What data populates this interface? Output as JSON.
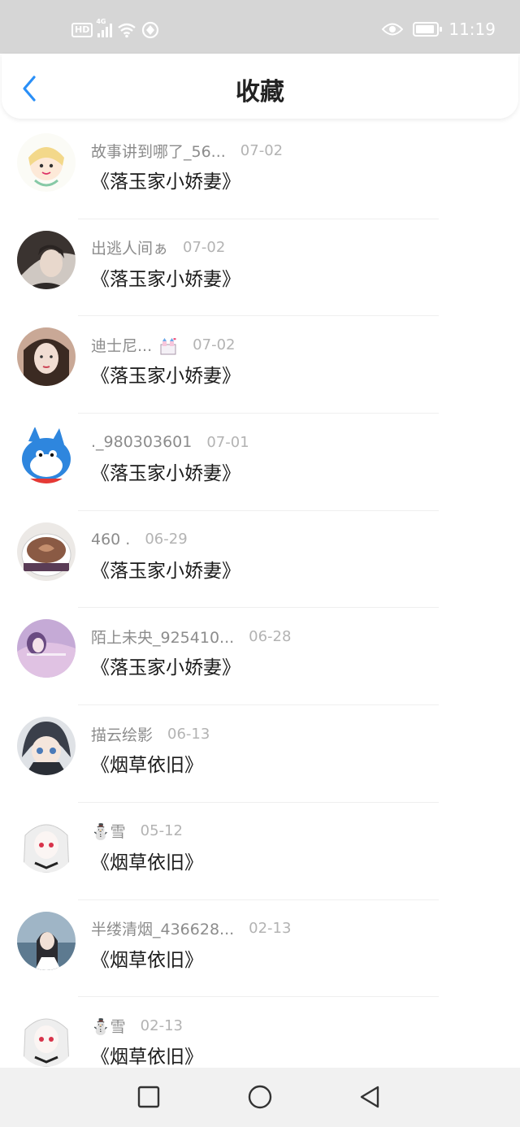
{
  "status_bar": {
    "left_badge": "HD",
    "network_type": "4G",
    "time": "11:19",
    "icons": [
      "signal-icon",
      "wifi-icon",
      "vpn-icon",
      "eye-icon",
      "battery-icon"
    ]
  },
  "header": {
    "title": "收藏",
    "back_icon": "chevron-left-icon",
    "accent_color": "#2a8ff7"
  },
  "favorites": [
    {
      "username": "故事讲到哪了_56...",
      "date": "07-02",
      "book": "《落玉家小娇妻》"
    },
    {
      "username": "出逃人间ぁ",
      "date": "07-02",
      "book": "《落玉家小娇妻》"
    },
    {
      "username": "迪士尼...",
      "date": "07-02",
      "book": "《落玉家小娇妻》"
    },
    {
      "username": "._980303601",
      "date": "07-01",
      "book": "《落玉家小娇妻》"
    },
    {
      "username": "460 .",
      "date": "06-29",
      "book": "《落玉家小娇妻》"
    },
    {
      "username": "陌上未央_925410...",
      "date": "06-28",
      "book": "《落玉家小娇妻》"
    },
    {
      "username": "描云绘影",
      "date": "06-13",
      "book": "《烟草依旧》"
    },
    {
      "username": "⛄雪",
      "date": "05-12",
      "book": "《烟草依旧》"
    },
    {
      "username": "半缕清烟_436628...",
      "date": "02-13",
      "book": "《烟草依旧》"
    },
    {
      "username": "⛄雪",
      "date": "02-13",
      "book": "《烟草依旧》"
    }
  ],
  "nav_bar": {
    "icons": [
      "recents-square-icon",
      "home-circle-icon",
      "back-triangle-icon"
    ]
  }
}
